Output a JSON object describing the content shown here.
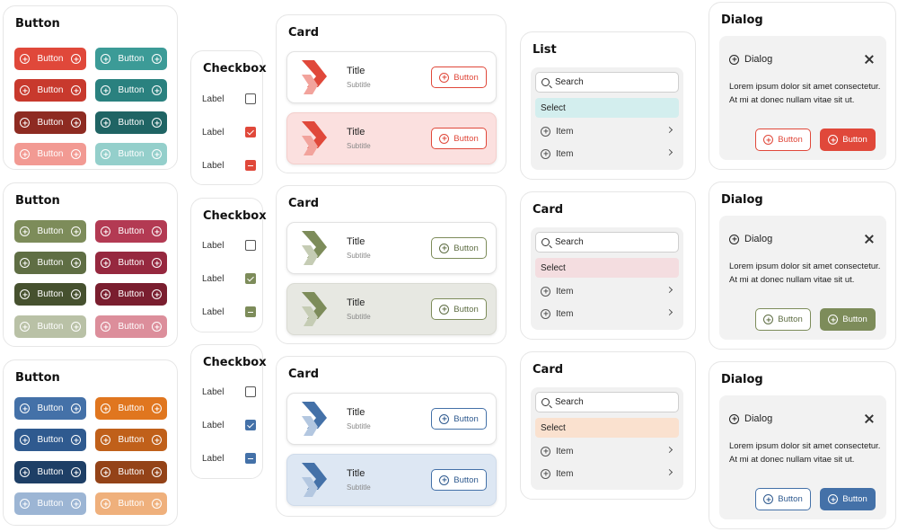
{
  "colors": {
    "red": [
      "#e0483a",
      "#c8392d",
      "#8e2b22",
      "#f29a93"
    ],
    "teal": [
      "#3c9b97",
      "#2a817f",
      "#1f6464",
      "#94cfcb"
    ],
    "olive": [
      "#7d8c5a",
      "#5f6e44",
      "#46512f",
      "#b9c1a6"
    ],
    "crimson": [
      "#b33a53",
      "#96283f",
      "#7a1e2f",
      "#dc8e9b"
    ],
    "blue": [
      "#4471a8",
      "#2f5a8f",
      "#1e3f66",
      "#9cb5d4"
    ],
    "orange": [
      "#e0761f",
      "#c0601a",
      "#944318",
      "#efb07c"
    ],
    "card_red_tint": "#fbe0df",
    "card_olive_tint": "#e7e8e2",
    "card_blue_tint": "#dde7f3"
  },
  "button_panels": [
    {
      "title": "Button",
      "button_label": "Button"
    },
    {
      "title": "Button",
      "button_label": "Button"
    },
    {
      "title": "Button",
      "button_label": "Button"
    }
  ],
  "checkbox_panels": [
    {
      "title": "Checkbox",
      "labels": [
        "Label",
        "Label",
        "Label"
      ]
    },
    {
      "title": "Checkbox",
      "labels": [
        "Label",
        "Label",
        "Label"
      ]
    },
    {
      "title": "Checkbox",
      "labels": [
        "Label",
        "Label",
        "Label"
      ]
    }
  ],
  "card_panels": [
    {
      "title": "Card",
      "items": [
        {
          "title": "Title",
          "subtitle": "Subtitle",
          "button": "Button"
        },
        {
          "title": "Title",
          "subtitle": "Subtitle",
          "button": "Button"
        }
      ]
    },
    {
      "title": "Card",
      "items": [
        {
          "title": "Title",
          "subtitle": "Subtitle",
          "button": "Button"
        },
        {
          "title": "Title",
          "subtitle": "Subtitle",
          "button": "Button"
        }
      ]
    },
    {
      "title": "Card",
      "items": [
        {
          "title": "Title",
          "subtitle": "Subtitle",
          "button": "Button"
        },
        {
          "title": "Title",
          "subtitle": "Subtitle",
          "button": "Button"
        }
      ]
    }
  ],
  "list_panels": [
    {
      "title": "List",
      "search_placeholder": "Search",
      "selected": "Select",
      "items": [
        "Item",
        "Item"
      ]
    },
    {
      "title": "Card",
      "search_placeholder": "Search",
      "selected": "Select",
      "items": [
        "Item",
        "Item"
      ]
    },
    {
      "title": "Card",
      "search_placeholder": "Search",
      "selected": "Select",
      "items": [
        "Item",
        "Item"
      ]
    }
  ],
  "dialog_panels": [
    {
      "title": "Dialog",
      "header": "Dialog",
      "body": "Lorem ipsum dolor sit amet consectetur. At mi at donec nullam vitae sit ut.",
      "secondary": "Button",
      "primary": "Button"
    },
    {
      "title": "Dialog",
      "header": "Dialog",
      "body": "Lorem ipsum dolor sit amet consectetur. At mi at donec nullam vitae sit ut.",
      "secondary": "Button",
      "primary": "Button"
    },
    {
      "title": "Dialog",
      "header": "Dialog",
      "body": "Lorem ipsum dolor sit amet consectetur. At mi at donec nullam vitae sit ut.",
      "secondary": "Button",
      "primary": "Button"
    }
  ]
}
